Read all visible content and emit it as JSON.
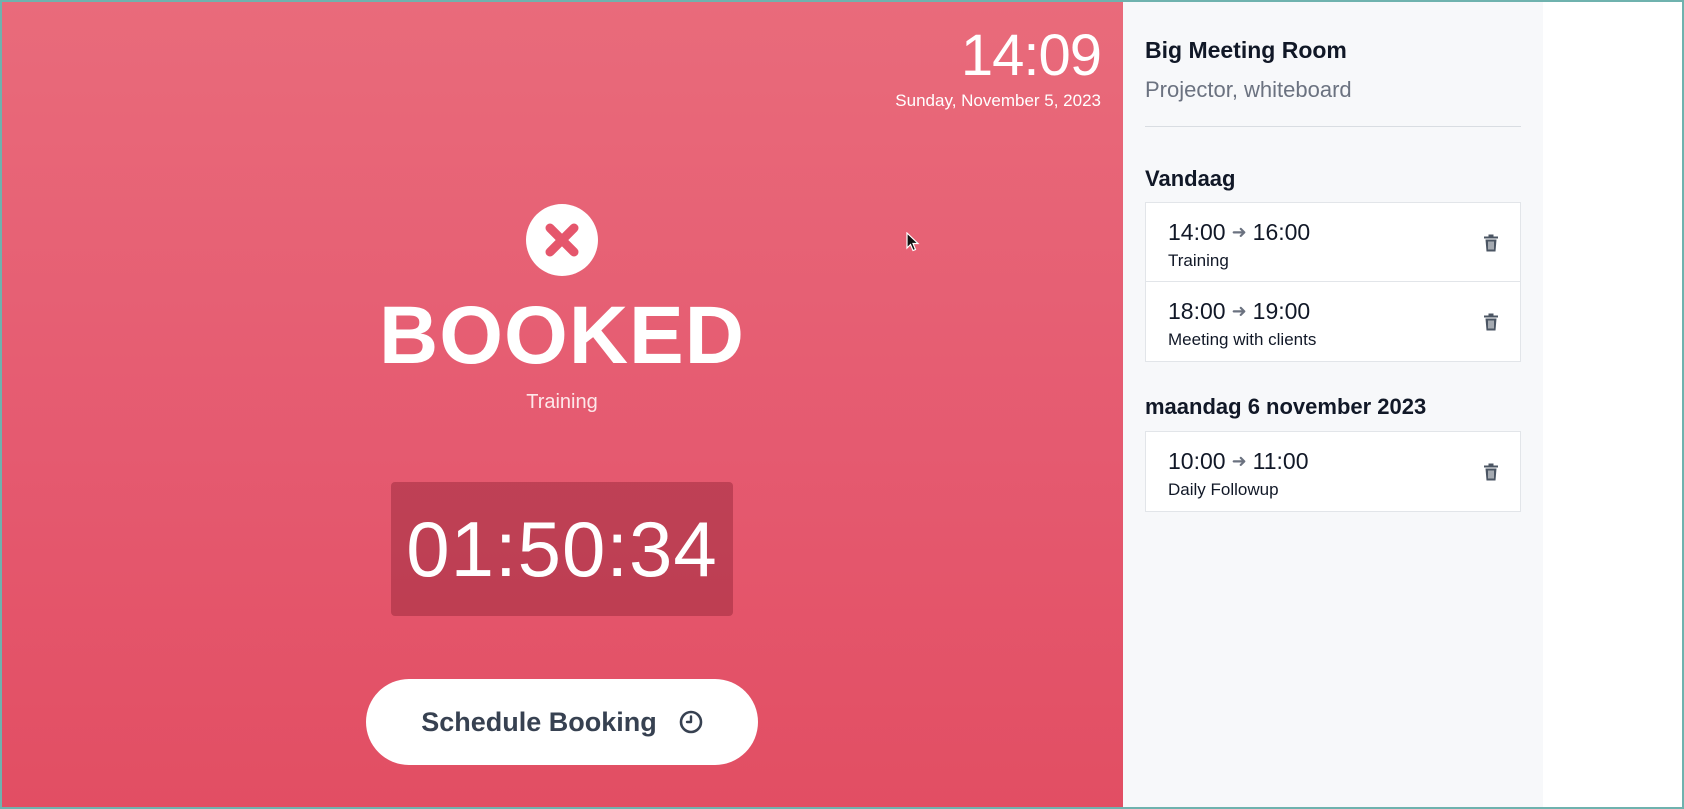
{
  "status": {
    "time": "14:09",
    "date": "Sunday, November 5, 2023",
    "label": "BOOKED",
    "current_booking": "Training",
    "countdown": "01:50:34",
    "schedule_button": "Schedule Booking",
    "background_color": "#e55a70"
  },
  "room": {
    "name": "Big Meeting Room",
    "features": "Projector, whiteboard"
  },
  "days": [
    {
      "heading": "Vandaag",
      "bookings": [
        {
          "start": "14:00",
          "end": "16:00",
          "title": "Training"
        },
        {
          "start": "18:00",
          "end": "19:00",
          "title": "Meeting with clients"
        }
      ]
    },
    {
      "heading": "maandag 6 november 2023",
      "bookings": [
        {
          "start": "10:00",
          "end": "11:00",
          "title": "Daily Followup"
        }
      ]
    }
  ],
  "icons": {
    "status": "x-circle-icon",
    "schedule": "clock-icon",
    "arrow": "arrow-right-icon",
    "delete": "trash-icon"
  }
}
